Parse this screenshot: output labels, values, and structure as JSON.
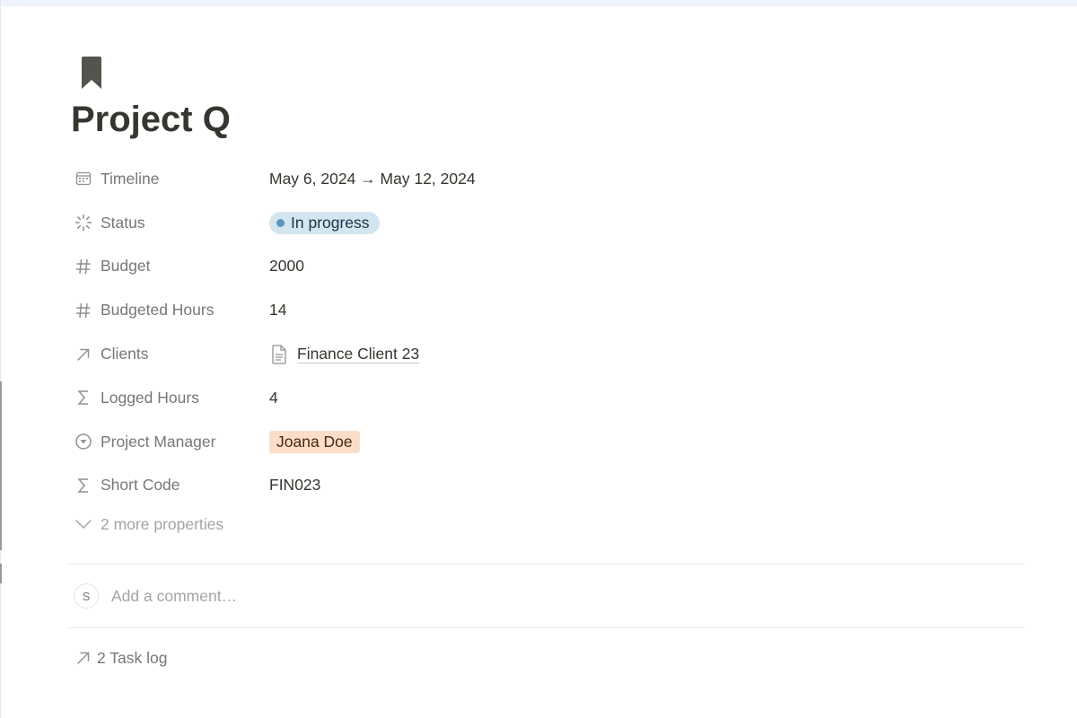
{
  "page": {
    "icon": "bookmark-icon",
    "title": "Project Q"
  },
  "properties": [
    {
      "key": "timeline",
      "icon": "calendar-icon",
      "label": "Timeline",
      "value": "May 6, 2024 → May 12, 2024"
    },
    {
      "key": "status",
      "icon": "status-spinner-icon",
      "label": "Status",
      "value": "In progress",
      "color": "#d3e5ef",
      "dot_color": "#5b97bd"
    },
    {
      "key": "budget",
      "icon": "hash-icon",
      "label": "Budget",
      "value": "2000"
    },
    {
      "key": "budgeted_hours",
      "icon": "hash-icon",
      "label": "Budgeted Hours",
      "value": "14"
    },
    {
      "key": "clients",
      "icon": "relation-arrow-icon",
      "label": "Clients",
      "value": "Finance Client 23",
      "value_icon": "document-icon"
    },
    {
      "key": "logged_hours",
      "icon": "sigma-icon",
      "label": "Logged Hours",
      "value": "4"
    },
    {
      "key": "project_manager",
      "icon": "select-circle-icon",
      "label": "Project Manager",
      "value": "Joana Doe",
      "color": "#fadec9"
    },
    {
      "key": "short_code",
      "icon": "sigma-icon",
      "label": "Short Code",
      "value": "FIN023"
    }
  ],
  "more_properties": {
    "icon": "chevron-down-icon",
    "label": "2 more properties"
  },
  "comment": {
    "avatar_initial": "S",
    "placeholder": "Add a comment…"
  },
  "backlinks": {
    "icon": "arrow-up-right-icon",
    "label": "2 Task log"
  }
}
